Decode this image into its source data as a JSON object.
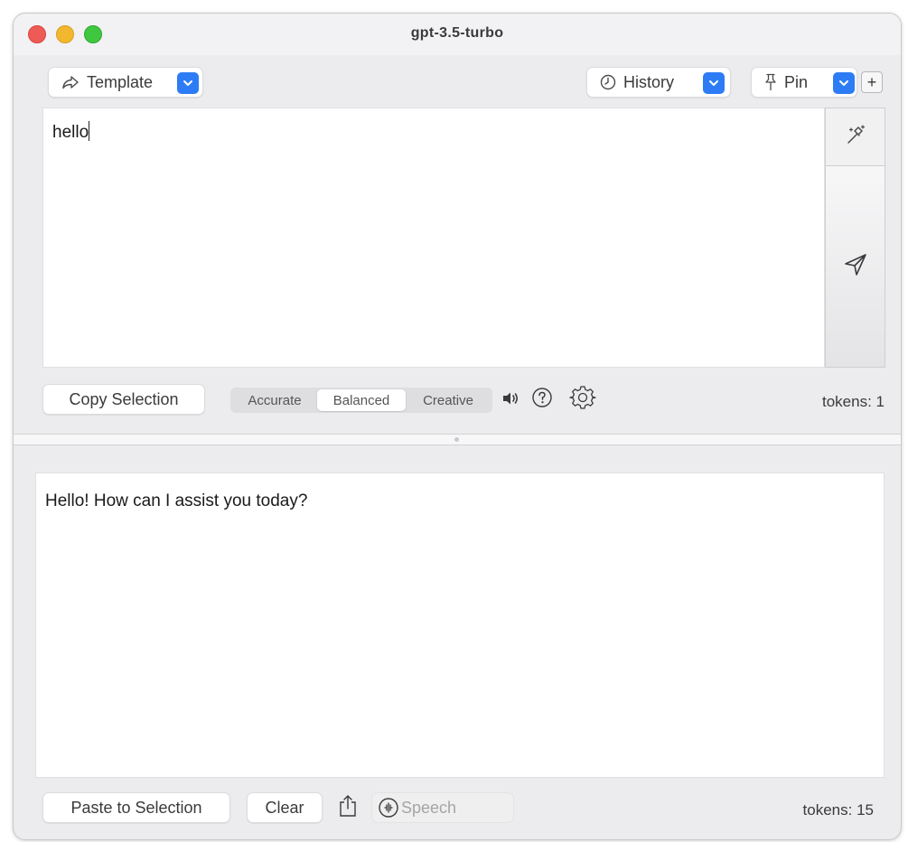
{
  "window": {
    "title": "gpt-3.5-turbo"
  },
  "toolbar": {
    "template_label": "Template",
    "history_label": "History",
    "pin_label": "Pin",
    "plus_label": "+"
  },
  "input": {
    "value": "hello"
  },
  "controls": {
    "copy_selection_label": "Copy Selection",
    "modes": [
      "Accurate",
      "Balanced",
      "Creative"
    ],
    "selected_mode": "Balanced",
    "tokens": "tokens: 1"
  },
  "output": {
    "text": "Hello! How can I assist you today?"
  },
  "footer": {
    "paste_label": "Paste to Selection",
    "clear_label": "Clear",
    "speech_label": "Speech",
    "tokens": "tokens: 15"
  },
  "colors": {
    "accent": "#2d7cf6",
    "close": "#ee5a55",
    "minimize": "#f3b72f",
    "zoom": "#3ec73f"
  },
  "icons": {
    "template": "share-arrow-icon",
    "history": "clock-icon",
    "pin": "pin-icon",
    "sidebar_top": "magic-wand-icon",
    "send": "paper-plane-icon",
    "speaker": "speaker-icon",
    "help": "question-circle-icon",
    "settings": "gear-icon",
    "share": "share-icon",
    "speech": "speech-icon"
  }
}
